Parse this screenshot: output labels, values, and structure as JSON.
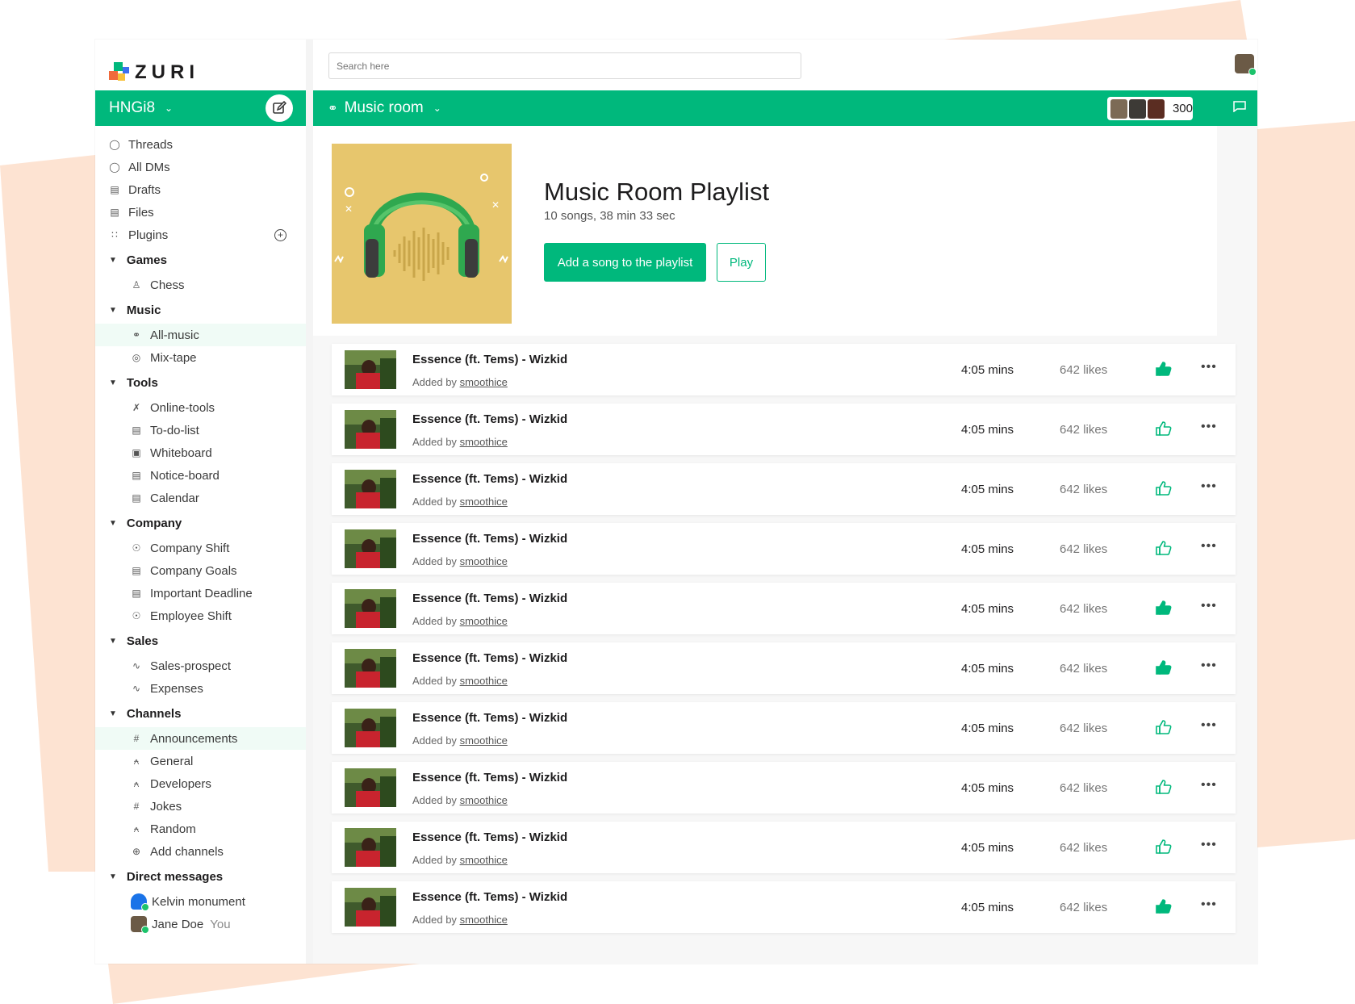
{
  "brand": {
    "name": "ZURI"
  },
  "workspace": {
    "name": "HNGi8"
  },
  "search": {
    "placeholder": "Search here"
  },
  "sidebar": {
    "top_items": [
      {
        "label": "Threads",
        "icon": "threads-icon"
      },
      {
        "label": "All DMs",
        "icon": "dms-icon"
      },
      {
        "label": "Drafts",
        "icon": "drafts-icon"
      },
      {
        "label": "Files",
        "icon": "files-icon"
      },
      {
        "label": "Plugins",
        "icon": "grid-icon"
      }
    ],
    "sections": [
      {
        "title": "Games",
        "items": [
          {
            "label": "Chess",
            "icon": "chess-icon"
          }
        ]
      },
      {
        "title": "Music",
        "items": [
          {
            "label": "All-music",
            "icon": "headphones-icon"
          },
          {
            "label": "Mix-tape",
            "icon": "disc-icon"
          }
        ]
      },
      {
        "title": "Tools",
        "items": [
          {
            "label": "Online-tools",
            "icon": "tools-icon"
          },
          {
            "label": "To-do-list",
            "icon": "list-icon"
          },
          {
            "label": "Whiteboard",
            "icon": "whiteboard-icon"
          },
          {
            "label": "Notice-board",
            "icon": "clipboard-icon"
          },
          {
            "label": "Calendar",
            "icon": "calendar-icon"
          }
        ]
      },
      {
        "title": "Company",
        "items": [
          {
            "label": "Company Shift",
            "icon": "shift-icon"
          },
          {
            "label": "Company Goals",
            "icon": "goals-icon"
          },
          {
            "label": "Important Deadline",
            "icon": "clipboard-icon"
          },
          {
            "label": "Employee Shift",
            "icon": "shift-icon"
          }
        ]
      },
      {
        "title": "Sales",
        "items": [
          {
            "label": "Sales-prospect",
            "icon": "chart-icon"
          },
          {
            "label": "Expenses",
            "icon": "chart-icon"
          }
        ]
      },
      {
        "title": "Channels",
        "items": [
          {
            "label": "Announcements",
            "icon": "hash-icon"
          },
          {
            "label": "General",
            "icon": "lock-icon"
          },
          {
            "label": "Developers",
            "icon": "lock-icon"
          },
          {
            "label": "Jokes",
            "icon": "hash-icon"
          },
          {
            "label": "Random",
            "icon": "lock-icon"
          },
          {
            "label": "Add channels",
            "icon": "plus-circle-icon"
          }
        ]
      },
      {
        "title": "Direct messages",
        "items": [
          {
            "label": "Kelvin monument",
            "icon": "user-icon"
          },
          {
            "label": "Jane Doe",
            "icon": "avatar-icon",
            "tag": "You"
          }
        ]
      }
    ]
  },
  "channel": {
    "name": "Music room",
    "member_count": "300"
  },
  "playlist": {
    "title": "Music Room Playlist",
    "meta": "10 songs, 38 min 33 sec",
    "add_label": "Add a song to the playlist",
    "play_label": "Play",
    "added_prefix": "Added by",
    "songs": [
      {
        "title": "Essence (ft. Tems) - Wizkid",
        "added_by": "smoothice",
        "duration": "4:05 mins",
        "likes": "642 likes",
        "liked": true
      },
      {
        "title": "Essence (ft. Tems) - Wizkid",
        "added_by": "smoothice",
        "duration": "4:05 mins",
        "likes": "642 likes",
        "liked": false
      },
      {
        "title": "Essence (ft. Tems) - Wizkid",
        "added_by": "smoothice",
        "duration": "4:05 mins",
        "likes": "642 likes",
        "liked": false
      },
      {
        "title": "Essence (ft. Tems) - Wizkid",
        "added_by": "smoothice",
        "duration": "4:05 mins",
        "likes": "642 likes",
        "liked": false
      },
      {
        "title": "Essence (ft. Tems) - Wizkid",
        "added_by": "smoothice",
        "duration": "4:05 mins",
        "likes": "642 likes",
        "liked": true
      },
      {
        "title": "Essence (ft. Tems) - Wizkid",
        "added_by": "smoothice",
        "duration": "4:05 mins",
        "likes": "642 likes",
        "liked": true
      },
      {
        "title": "Essence (ft. Tems) - Wizkid",
        "added_by": "smoothice",
        "duration": "4:05 mins",
        "likes": "642 likes",
        "liked": false
      },
      {
        "title": "Essence (ft. Tems) - Wizkid",
        "added_by": "smoothice",
        "duration": "4:05 mins",
        "likes": "642 likes",
        "liked": false
      },
      {
        "title": "Essence (ft. Tems) - Wizkid",
        "added_by": "smoothice",
        "duration": "4:05 mins",
        "likes": "642 likes",
        "liked": false
      },
      {
        "title": "Essence (ft. Tems) - Wizkid",
        "added_by": "smoothice",
        "duration": "4:05 mins",
        "likes": "642 likes",
        "liked": true
      }
    ]
  },
  "colors": {
    "accent": "#00b87c",
    "background_shape": "#fde3d2",
    "cover": "#e7c66d"
  }
}
